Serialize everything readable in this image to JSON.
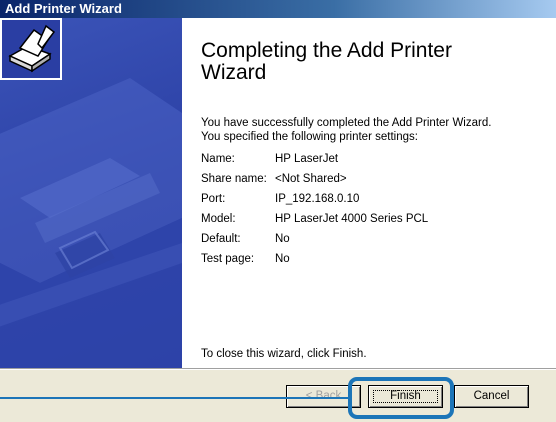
{
  "window": {
    "title": "Add Printer Wizard"
  },
  "main": {
    "heading": "Completing the Add Printer Wizard",
    "message_line1": "You have successfully completed the Add Printer Wizard.",
    "message_line2": "You specified the following printer settings:",
    "settings": [
      {
        "label": "Name:",
        "value": "HP LaserJet"
      },
      {
        "label": "Share name:",
        "value": "<Not Shared>"
      },
      {
        "label": "Port:",
        "value": "IP_192.168.0.10"
      },
      {
        "label": "Model:",
        "value": "HP LaserJet 4000 Series PCL"
      },
      {
        "label": "Default:",
        "value": "No"
      },
      {
        "label": "Test page:",
        "value": "No"
      }
    ],
    "close_text": "To close this wizard, click Finish."
  },
  "buttons": {
    "back": "< Back",
    "finish": "Finish",
    "cancel": "Cancel"
  },
  "colors": {
    "title_bar": "#0a246a",
    "side_panel": "#2a3ea3",
    "highlight": "#1c75b8"
  }
}
